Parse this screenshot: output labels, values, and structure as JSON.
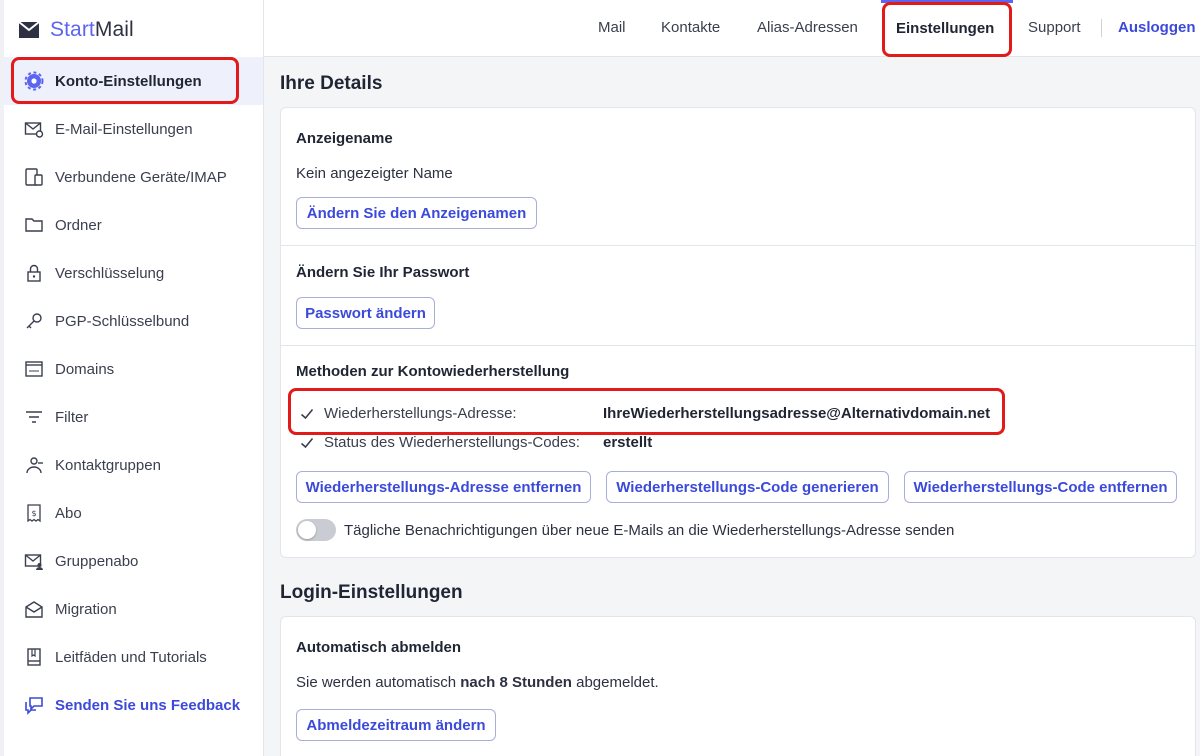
{
  "app": {
    "brand_first": "Start",
    "brand_second": "Mail",
    "accent_color": "#5c64f0",
    "link_color": "#3c4ad9",
    "highlight_color": "#e11a1a"
  },
  "topnav": {
    "mail": "Mail",
    "contacts": "Kontakte",
    "aliases": "Alias-Adressen",
    "settings": "Einstellungen",
    "support": "Support",
    "logout": "Ausloggen"
  },
  "sidebar": {
    "items": [
      {
        "label": "Konto-Einstellungen",
        "icon": "gear-icon",
        "active": true
      },
      {
        "label": "E-Mail-Einstellungen",
        "icon": "mail-settings-icon"
      },
      {
        "label": "Verbundene Geräte/IMAP",
        "icon": "devices-icon"
      },
      {
        "label": "Ordner",
        "icon": "folder-icon"
      },
      {
        "label": "Verschlüsselung",
        "icon": "lock-icon"
      },
      {
        "label": "PGP-Schlüsselbund",
        "icon": "key-icon"
      },
      {
        "label": "Domains",
        "icon": "domain-icon"
      },
      {
        "label": "Filter",
        "icon": "filter-icon"
      },
      {
        "label": "Kontaktgruppen",
        "icon": "contact-groups-icon"
      },
      {
        "label": "Abo",
        "icon": "receipt-icon"
      },
      {
        "label": "Gruppenabo",
        "icon": "group-mail-icon"
      },
      {
        "label": "Migration",
        "icon": "migration-icon"
      },
      {
        "label": "Leitfäden und Tutorials",
        "icon": "book-icon"
      },
      {
        "label": "Senden Sie uns Feedback",
        "icon": "feedback-icon"
      }
    ]
  },
  "details": {
    "title": "Ihre Details",
    "display_name": {
      "heading": "Anzeigename",
      "value": "Kein angezeigter Name",
      "button": "Ändern Sie den Anzeigenamen"
    },
    "password": {
      "heading": "Ändern Sie Ihr Passwort",
      "button": "Passwort ändern"
    },
    "recovery": {
      "heading": "Methoden zur Kontowiederherstellung",
      "address_label": "Wiederherstellungs-Adresse:",
      "address_value": "IhreWiederherstellungsadresse@Alternativdomain.net",
      "code_label": "Status des Wiederherstellungs-Codes:",
      "code_value": "erstellt",
      "btn_remove_address": "Wiederherstellungs-Adresse entfernen",
      "btn_generate_code": "Wiederherstellungs-Code generieren",
      "btn_remove_code": "Wiederherstellungs-Code entfernen",
      "daily_notifications": "Tägliche Benachrichtigungen über neue E-Mails an die Wiederherstellungs-Adresse senden",
      "daily_notifications_on": false
    }
  },
  "login": {
    "title": "Login-Einstellungen",
    "auto_logout": {
      "heading": "Automatisch abmelden",
      "text_before": "Sie werden automatisch",
      "text_bold": "nach 8 Stunden",
      "text_after": "abgemeldet.",
      "button": "Abmeldezeitraum ändern"
    }
  }
}
